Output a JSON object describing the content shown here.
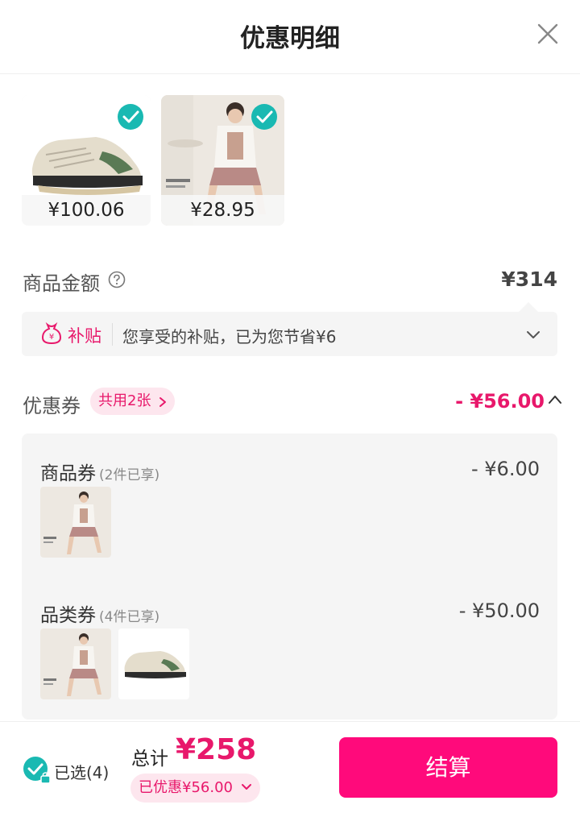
{
  "header": {
    "title": "优惠明细",
    "close_icon": "close-icon"
  },
  "selected_items": [
    {
      "price": "¥100.06",
      "checked": true
    },
    {
      "price": "¥28.95",
      "checked": true
    }
  ],
  "amount": {
    "label": "商品金额",
    "value": "¥314"
  },
  "subsidy": {
    "tag": "补贴",
    "text": "您享受的补贴，已为您节省¥6"
  },
  "coupons": {
    "label": "优惠券",
    "badge": "共用2张",
    "total": "- ¥56.00",
    "items": [
      {
        "name": "商品券",
        "note": "(2件已享)",
        "amount": "- ¥6.00"
      },
      {
        "name": "品类券",
        "note": "(4件已享)",
        "amount": "- ¥50.00"
      }
    ]
  },
  "footer": {
    "selected_text": "已选(4)",
    "total_label": "总计",
    "total_value": "¥258",
    "saved_text": "已优惠¥56.00",
    "checkout_label": "结算"
  },
  "colors": {
    "accent": "#e8186b",
    "button": "#ff0a7b",
    "check": "#1ab9b2"
  }
}
